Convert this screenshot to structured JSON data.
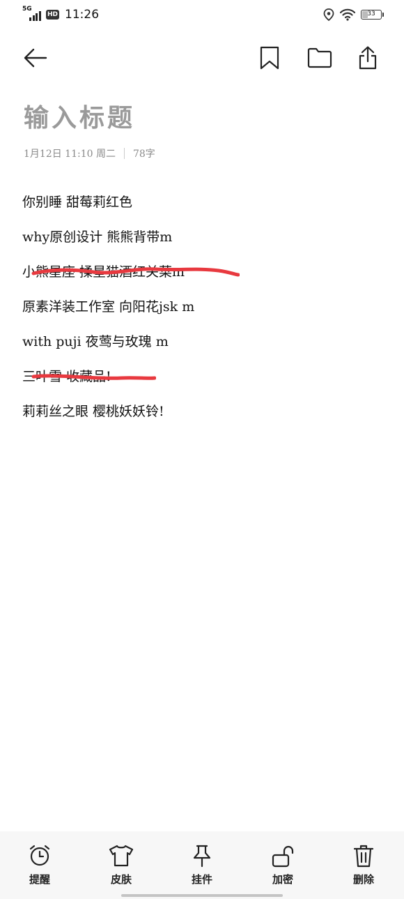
{
  "status_bar": {
    "network": "5G",
    "hd": "HD",
    "time": "11:26",
    "battery": "33",
    "battery_level": 0.33,
    "icons": [
      "location-icon",
      "wifi-icon",
      "battery-icon"
    ]
  },
  "toolbar": {
    "back_icon": "back-arrow-icon",
    "bookmark_icon": "bookmark-icon",
    "folder_icon": "folder-icon",
    "share_icon": "share-icon"
  },
  "note": {
    "title_placeholder": "输入标题",
    "date": "1月12日 11:10 周二",
    "word_count": "78字"
  },
  "lines": [
    {
      "text": "你别睡 甜莓莉红色",
      "struck": false
    },
    {
      "text": "why原创设计 熊熊背带m",
      "struck": false
    },
    {
      "text": "小熊星座 揉星猫酒红关菜m",
      "struck": true
    },
    {
      "text": "原素洋装工作室 向阳花jsk m",
      "struck": false
    },
    {
      "text": "with puji 夜莺与玫瑰 m",
      "struck": false
    },
    {
      "text": "三叶雪 收藏品!",
      "struck": true
    },
    {
      "text": "莉莉丝之眼 樱桃妖妖铃!",
      "struck": false
    }
  ],
  "bottom_bar": {
    "remind": "提醒",
    "skin": "皮肤",
    "pin": "挂件",
    "encrypt": "加密",
    "delete": "删除"
  },
  "colors": {
    "strike": "#e8393f",
    "title_placeholder": "#9a9a9a",
    "bottom_bar_bg": "#f7f7f7"
  }
}
